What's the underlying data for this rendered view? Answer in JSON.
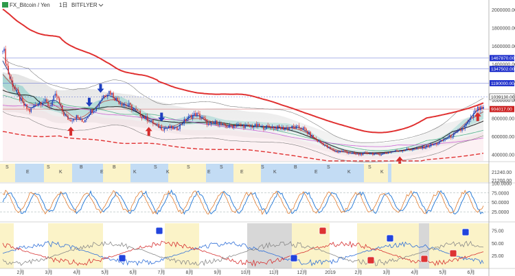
{
  "header": {
    "symbol": "FX_Bitcoin / Yen",
    "interval": "1日",
    "exchange": "BITFLYER",
    "dropdown_icon": "chevron-down-icon",
    "flag_icon": "exchange-flag-icon"
  },
  "colors": {
    "up": "#1e3fbf",
    "down": "#d62d2d",
    "bb_red": "#e03030",
    "kumo_fill": "#cfcfcf",
    "teal_band": "#7fc8c0",
    "pane_blue": "#a9cdf0",
    "pane_yellow": "#fbf3c8",
    "pane_gray": "#d7d7d7",
    "tag_blue": "#2233cc",
    "tag_red": "#cc2222"
  },
  "chart_data": [
    {
      "type": "candlestick",
      "pane": "price",
      "title": "FX_Bitcoin / Yen 1日 BITFLYER",
      "x_tick_labels": [
        "2月",
        "3月",
        "4月",
        "5月",
        "6月",
        "7月",
        "8月",
        "9月",
        "10月",
        "11月",
        "12月",
        "2019",
        "2月",
        "3月",
        "4月",
        "5月",
        "6月"
      ],
      "y_tick_labels": [
        "2000000.00",
        "1800000.00",
        "1600000.00",
        "1400000.00",
        "1200000.00",
        "1000000.00",
        "800000.00",
        "600000.00",
        "400000.00"
      ],
      "ylim": [
        330000,
        2080000
      ],
      "price_tags": [
        {
          "text": "1467870.00",
          "value": 1467870,
          "color": "blue"
        },
        {
          "text": "1347502.00",
          "value": 1347502,
          "color": "blue"
        },
        {
          "text": "1190000.00",
          "value": 1190000,
          "color": "blue"
        },
        {
          "text": "1039130.00",
          "value": 1039130,
          "color": "white"
        },
        {
          "text": "904017.00",
          "value": 904017,
          "color": "red"
        }
      ],
      "close_approx": [
        1600000,
        1250000,
        1100000,
        960000,
        880000,
        960000,
        1000000,
        940000,
        1060000,
        860000,
        780000,
        820000,
        760000,
        870000,
        920000,
        1050000,
        1100000,
        1010000,
        960000,
        940000,
        880000,
        820000,
        780000,
        720000,
        690000,
        700000,
        680000,
        760000,
        820000,
        850000,
        800000,
        720000,
        760000,
        720000,
        710000,
        730000,
        720000,
        710000,
        720000,
        700000,
        710000,
        700000,
        690000,
        700000,
        700000,
        690000,
        620000,
        560000,
        520000,
        460000,
        430000,
        440000,
        420000,
        400000,
        410000,
        420000,
        400000,
        410000,
        430000,
        440000,
        450000,
        460000,
        460000,
        480000,
        500000,
        520000,
        560000,
        600000,
        640000,
        690000,
        780000,
        900000,
        904017
      ],
      "signal_labels": [
        "Buy",
        "Sell"
      ]
    },
    {
      "type": "labels",
      "pane": "signal",
      "y_tick_labels": [
        "21240.00",
        "21200.00"
      ],
      "letters": [
        "S",
        "E",
        "S",
        "K",
        "B",
        "E",
        "B",
        "K",
        "S",
        "K",
        "S",
        "E",
        "S",
        "E",
        "S",
        "K",
        "B",
        "E",
        "S",
        "K",
        "S",
        "K"
      ]
    },
    {
      "type": "line",
      "pane": "oscillator",
      "y_tick_labels": [
        "100.0000",
        "75.0000",
        "50.0000",
        "25.0000"
      ],
      "ylim": [
        0,
        100
      ],
      "series": [
        {
          "name": "",
          "color": "#2f7fd8"
        },
        {
          "name": "",
          "color": "#e07b2f"
        }
      ]
    },
    {
      "type": "line",
      "pane": "dmi",
      "y_tick_labels": [
        "75.00",
        "50.00",
        "25.00"
      ],
      "ylim": [
        0,
        90
      ],
      "series": [
        {
          "name": "",
          "color": "#2f6fd8"
        },
        {
          "name": "",
          "color": "#d63030"
        },
        {
          "name": "",
          "color": "#888888"
        }
      ]
    }
  ]
}
